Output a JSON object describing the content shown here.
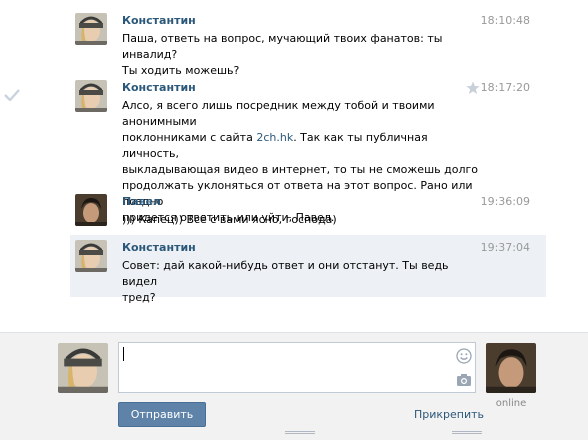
{
  "messages": [
    {
      "author": "Константин",
      "time": "18:10:48",
      "text": "Паша, ответь на вопрос, мучающий твоих фанатов: ты инвалид?\nТы ходить можешь?"
    },
    {
      "author": "Константин",
      "time": "18:17:20",
      "text_before": "Алсо, я всего лишь посредник между тобой и твоими анонимными\nпоклонниками с сайта ",
      "link": "2ch.hk",
      "text_after": ". Так как ты публичная личность,\nвыкладывающая видео в интернет, то ты не сможешь долго\nпродолжать уклоняться от ответа на этот вопрос. Рано или поздно\nпридется ответить или уйти, Павел."
    },
    {
      "author": "Павел",
      "time": "19:36:09",
      "text": "))) Капец)) Всё с вами ясно, господа)"
    },
    {
      "author": "Константин",
      "time": "19:37:04",
      "text": "Совет: дай какой-нибудь ответ и они отстанут. Ты ведь видел\nтред?"
    }
  ],
  "composer": {
    "send_label": "Отправить",
    "attach_label": "Прикрепить",
    "online_label": "online"
  },
  "icons": {
    "check": "check-icon",
    "star": "star-icon",
    "smile": "smile-icon",
    "camera": "camera-icon"
  },
  "colors": {
    "author_link": "#2b587a",
    "highlight": "#edf1f5",
    "send_button": "#5e82a8",
    "composer_bg": "#f2f2f2"
  }
}
